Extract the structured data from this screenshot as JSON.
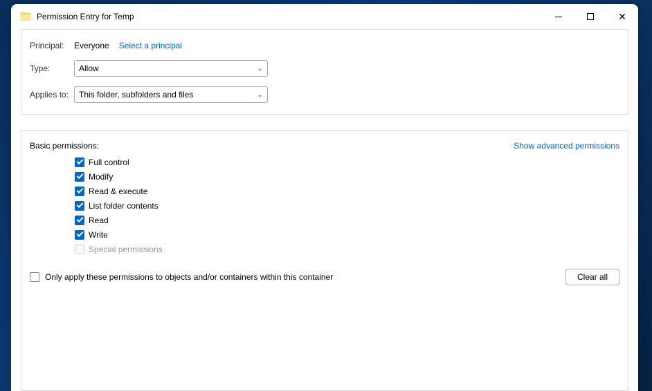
{
  "title": "Permission Entry for Temp",
  "header": {
    "principal_label": "Principal:",
    "principal_value": "Everyone",
    "select_link": "Select a principal",
    "type_label": "Type:",
    "type_value": "Allow",
    "applies_label": "Applies to:",
    "applies_value": "This folder, subfolders and files"
  },
  "perms": {
    "section_label": "Basic permissions:",
    "advanced_link": "Show advanced permissions",
    "items": [
      {
        "label": "Full control",
        "checked": true,
        "enabled": true
      },
      {
        "label": "Modify",
        "checked": true,
        "enabled": true
      },
      {
        "label": "Read & execute",
        "checked": true,
        "enabled": true
      },
      {
        "label": "List folder contents",
        "checked": true,
        "enabled": true
      },
      {
        "label": "Read",
        "checked": true,
        "enabled": true
      },
      {
        "label": "Write",
        "checked": true,
        "enabled": true
      },
      {
        "label": "Special permissions",
        "checked": false,
        "enabled": false
      }
    ],
    "only_apply_label": "Only apply these permissions to objects and/or containers within this container",
    "only_apply_checked": false,
    "clear_all": "Clear all"
  }
}
